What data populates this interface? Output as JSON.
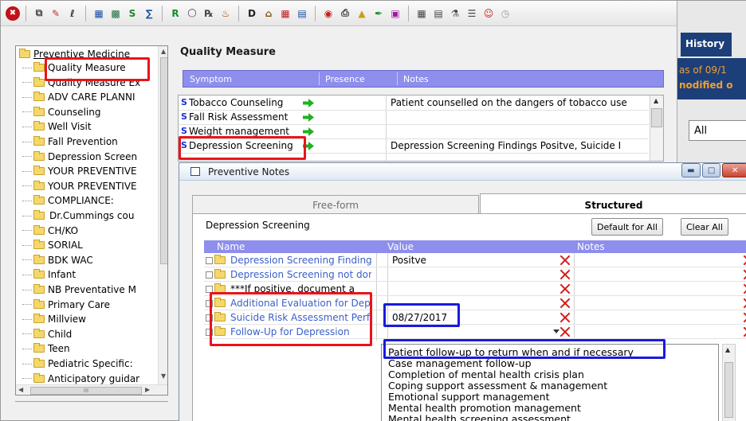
{
  "toolbar": {
    "icons": [
      "stop-icon",
      "copy-icon",
      "brush-icon",
      "signature-icon",
      "form-icon",
      "calculator-icon",
      "s-icon",
      "fx-icon",
      "r-icon",
      "eyeglasses-icon",
      "rx-icon",
      "paste-icon",
      "dx-icon",
      "building-icon",
      "table-icon",
      "chart-icon",
      "glasses-icon",
      "printer-icon",
      "bell-icon",
      "pen-icon",
      "monitor-icon",
      "grid-icon",
      "note-icon",
      "flask-icon",
      "list-icon",
      "doctor-icon",
      "time-icon"
    ],
    "letters": {
      "s": "S",
      "r": "R"
    }
  },
  "background_window": {
    "history_tab": "History",
    "line1": "as of 09/1",
    "line2": "nodified o",
    "select_value": "All"
  },
  "tree": {
    "root_label": "Preventive Medicine",
    "items": [
      "Quality Measure",
      "Quality Measure Ex",
      "ADV CARE PLANNI",
      "Counseling",
      "Well Visit",
      "Fall Prevention",
      "Depression Screen",
      "YOUR PREVENTIVE",
      "YOUR PREVENTIVE",
      "COMPLIANCE:",
      "Dr.Cummings cou",
      "CH/KO",
      "SORIAL",
      "BDK WAC",
      "Infant",
      "NB Preventative M",
      "Primary Care",
      "Millview",
      "Child",
      "Teen",
      "Pediatric Specific:",
      "Anticipatory guidar"
    ],
    "hscroll_grip": "III"
  },
  "quality_measure": {
    "title": "Quality Measure",
    "columns": {
      "symptom": "Symptom",
      "presence": "Presence",
      "notes": "Notes"
    },
    "rows": [
      {
        "flag": "S",
        "symptom": "Tobacco Counseling",
        "notes": "Patient counselled on the dangers of tobacco use"
      },
      {
        "flag": "S",
        "symptom": "Fall Risk Assessment",
        "notes": ""
      },
      {
        "flag": "S",
        "symptom": "Weight management",
        "notes": ""
      },
      {
        "flag": "S",
        "symptom": "Depression Screening",
        "notes": "Depression Screening Findings Positve, Suicide I"
      }
    ]
  },
  "dialog": {
    "title": "Preventive Notes",
    "tabs": {
      "free_form": "Free-form",
      "structured": "Structured"
    },
    "section_label": "Depression Screening",
    "buttons": {
      "default_for_all": "Default for All",
      "clear_all": "Clear All"
    },
    "columns": {
      "name": "Name",
      "value": "Value",
      "notes": "Notes"
    },
    "rows": [
      {
        "name": "Depression Screening Findings",
        "value": "Positve",
        "linked": true
      },
      {
        "name": "Depression Screening not done",
        "value": "",
        "linked": true
      },
      {
        "name": "***If positive, document a",
        "value": "",
        "linked": false
      },
      {
        "name": "Additional Evaluation for Depression",
        "value": "",
        "linked": true
      },
      {
        "name": "Suicide Risk Assessment Performed",
        "value": "08/27/2017",
        "linked": true
      },
      {
        "name": "Follow-Up for Depression",
        "value": "",
        "linked": true
      }
    ],
    "dropdown_options": [
      "Patient follow-up to return when and if necessary",
      "Case management follow-up",
      "Completion of mental health crisis plan",
      "Coping support assessment & management",
      "Emotional support management",
      "Mental health promotion management",
      "Mental health screening assessment"
    ]
  }
}
